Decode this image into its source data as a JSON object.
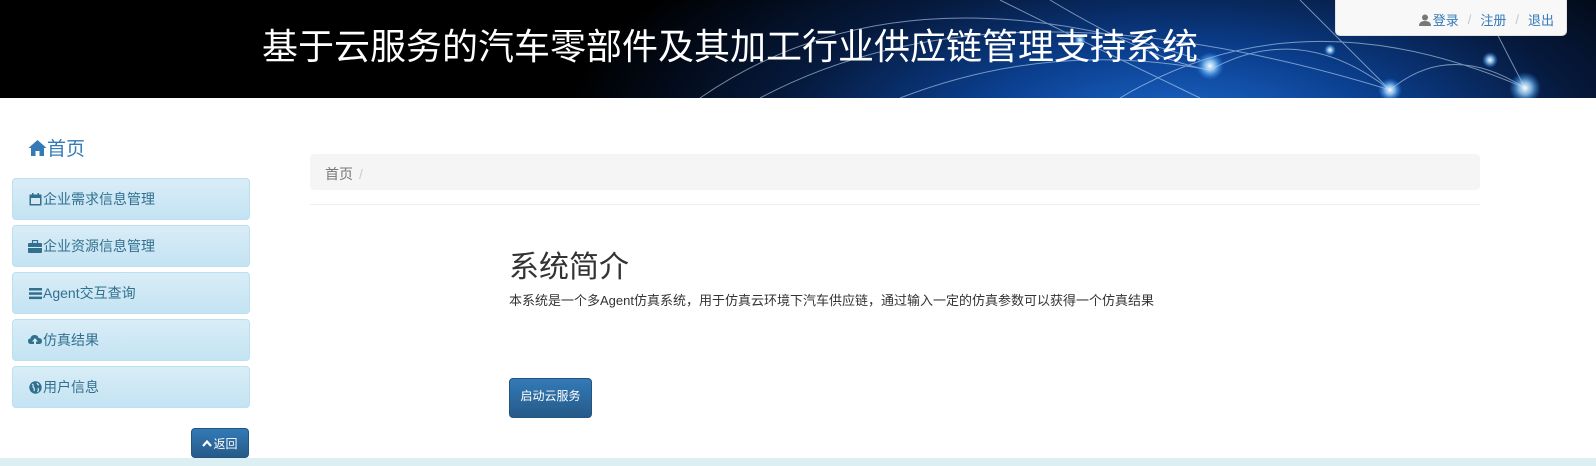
{
  "header": {
    "title": "基于云服务的汽车零部件及其加工行业供应链管理支持系统",
    "user_links": [
      {
        "label": "登录",
        "icon": "user-icon"
      },
      {
        "label": "注册"
      },
      {
        "label": "退出"
      }
    ]
  },
  "sidebar": {
    "home_label": "首页",
    "items": [
      {
        "label": "企业需求信息管理",
        "icon": "calendar-icon"
      },
      {
        "label": "企业资源信息管理",
        "icon": "briefcase-icon"
      },
      {
        "label": "Agent交互查询",
        "icon": "list-icon"
      },
      {
        "label": "仿真结果",
        "icon": "cloud-upload-icon"
      },
      {
        "label": "用户信息",
        "icon": "globe-icon"
      }
    ],
    "back_label": "返回"
  },
  "main": {
    "breadcrumb": [
      "首页"
    ],
    "intro_title": "系统简介",
    "intro_text": "本系统是一个多Agent仿真系统，用于仿真云环境下汽车供应链，通过输入一定的仿真参数可以获得一个仿真结果",
    "start_button": "启动云服务"
  },
  "colors": {
    "link": "#337ab7",
    "sidebar_bg": "#d9edf7",
    "sidebar_text": "#31708f",
    "primary_button": "#337ab7"
  }
}
